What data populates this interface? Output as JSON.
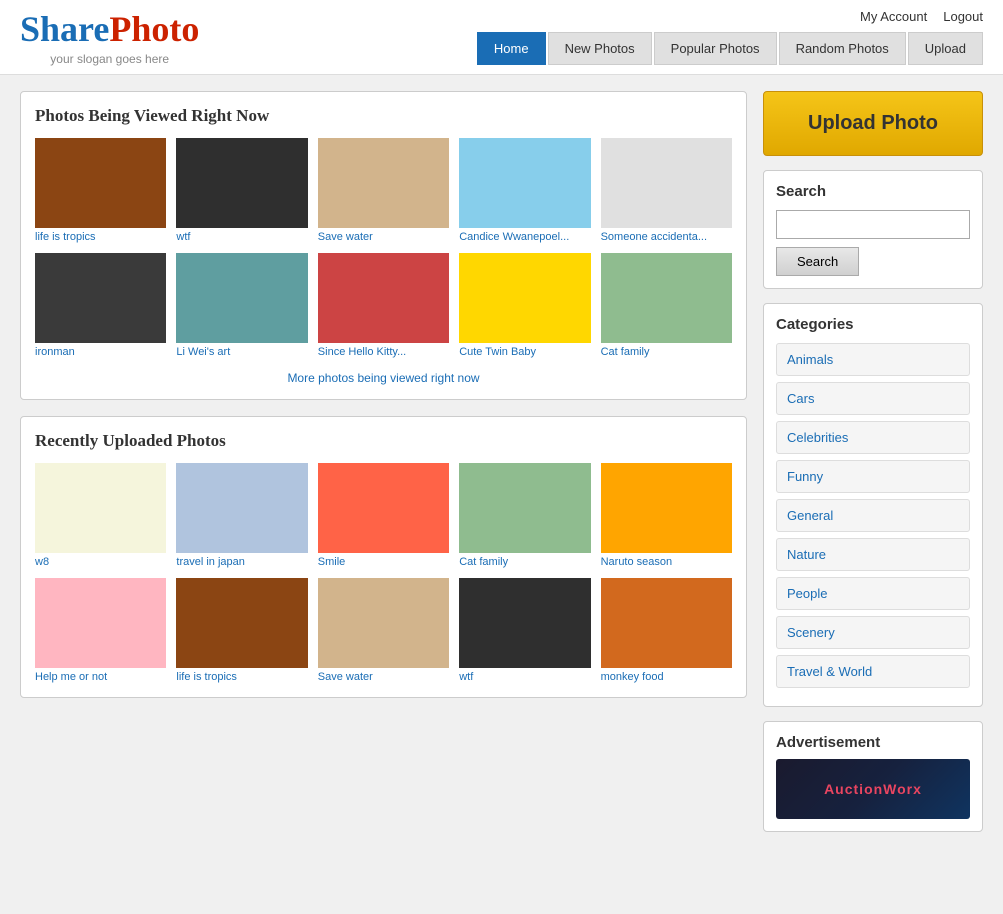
{
  "header": {
    "logo_share": "Share",
    "logo_photo": "Photo",
    "slogan": "your slogan goes here",
    "my_account": "My Account",
    "logout": "Logout"
  },
  "nav": {
    "items": [
      {
        "label": "Home",
        "active": true
      },
      {
        "label": "New Photos",
        "active": false
      },
      {
        "label": "Popular Photos",
        "active": false
      },
      {
        "label": "Random Photos",
        "active": false
      },
      {
        "label": "Upload",
        "active": false
      }
    ]
  },
  "sections": {
    "viewed_title": "Photos Being Viewed Right Now",
    "recently_title": "Recently Uploaded Photos",
    "more_link": "More photos being viewed right now"
  },
  "viewed_photos": [
    {
      "label": "life is tropics",
      "color": "#8B4513"
    },
    {
      "label": "wtf",
      "color": "#2F2F2F"
    },
    {
      "label": "Save water",
      "color": "#D2B48C"
    },
    {
      "label": "Candice Wwanepoel...",
      "color": "#87CEEB"
    },
    {
      "label": "Someone accidenta...",
      "color": "#E0E0E0"
    },
    {
      "label": "ironman",
      "color": "#3A3A3A"
    },
    {
      "label": "Li Wei's art",
      "color": "#5F9EA0"
    },
    {
      "label": "Since Hello Kitty...",
      "color": "#CC4444"
    },
    {
      "label": "Cute Twin Baby",
      "color": "#FFD700"
    },
    {
      "label": "Cat family",
      "color": "#8FBC8F"
    }
  ],
  "recent_photos": [
    {
      "label": "w8",
      "color": "#F5F5DC"
    },
    {
      "label": "travel in japan",
      "color": "#B0C4DE"
    },
    {
      "label": "Smile",
      "color": "#FF6347"
    },
    {
      "label": "Cat family",
      "color": "#8FBC8F"
    },
    {
      "label": "Naruto season",
      "color": "#FFA500"
    },
    {
      "label": "Help me or not",
      "color": "#FFB6C1"
    },
    {
      "label": "life is tropics",
      "color": "#8B4513"
    },
    {
      "label": "Save water",
      "color": "#D2B48C"
    },
    {
      "label": "wtf",
      "color": "#2F2F2F"
    },
    {
      "label": "monkey food",
      "color": "#D2691E"
    }
  ],
  "sidebar": {
    "upload_label": "Upload Photo",
    "search_title": "Search",
    "search_placeholder": "",
    "search_btn": "Search",
    "categories_title": "Categories",
    "categories": [
      "Animals",
      "Cars",
      "Celebrities",
      "Funny",
      "General",
      "Nature",
      "People",
      "Scenery",
      "Travel & World"
    ],
    "ad_title": "Advertisement",
    "ad_text": "AuctionWorx"
  }
}
